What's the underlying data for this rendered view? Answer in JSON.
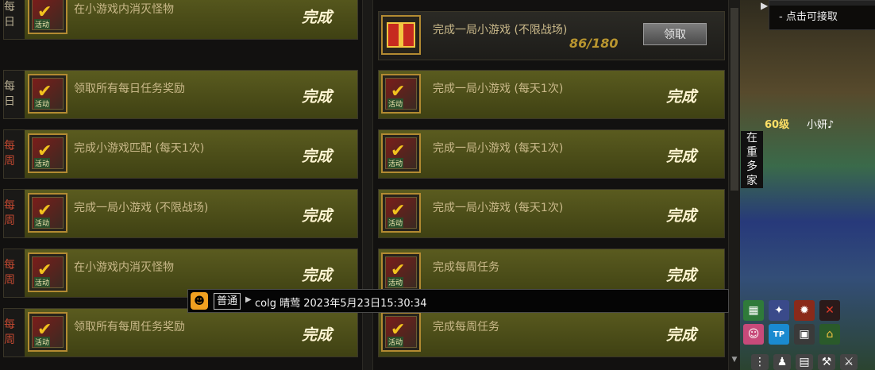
{
  "tooltip": {
    "text": "- 点击可接取"
  },
  "tasks_left": [
    {
      "period": "每日",
      "kind": "daily",
      "text": "在小游戏内消灭怪物",
      "status": "完成"
    },
    {
      "period": "每日",
      "kind": "daily",
      "text": "领取所有每日任务奖励",
      "status": "完成"
    },
    {
      "period": "每周",
      "kind": "weekly",
      "text": "完成小游戏匹配 (每天1次)",
      "status": "完成"
    },
    {
      "period": "每周",
      "kind": "weekly",
      "text": "完成一局小游戏 (不限战场)",
      "status": "完成"
    },
    {
      "period": "每周",
      "kind": "weekly",
      "text": "在小游戏内消灭怪物",
      "status": "完成"
    },
    {
      "period": "每周",
      "kind": "weekly",
      "text": "领取所有每周任务奖励",
      "status": "完成"
    }
  ],
  "tasks_right": [
    {
      "text": "完成一局小游戏 (不限战场)",
      "progress": "86/180",
      "button": "领取"
    },
    {
      "text": "完成一局小游戏 (每天1次)",
      "status": "完成"
    },
    {
      "text": "完成一局小游戏 (每天1次)",
      "status": "完成"
    },
    {
      "text": "完成一局小游戏 (每天1次)",
      "status": "完成"
    },
    {
      "text": "完成每周任务",
      "status": "完成"
    },
    {
      "text": "完成每周任务",
      "status": "完成"
    }
  ],
  "icon_label": "活动",
  "character": {
    "level": "60级",
    "name": "小妍♪"
  },
  "side_text": [
    "在",
    "重",
    "多",
    "家"
  ],
  "chat": {
    "channel": "普通",
    "message": "colg 晴莺 2023年5月23日15:30:34"
  },
  "colors": {
    "done_row": "#5a5b1f",
    "weekly_tag": "#c04830",
    "progress": "#b8952f"
  }
}
